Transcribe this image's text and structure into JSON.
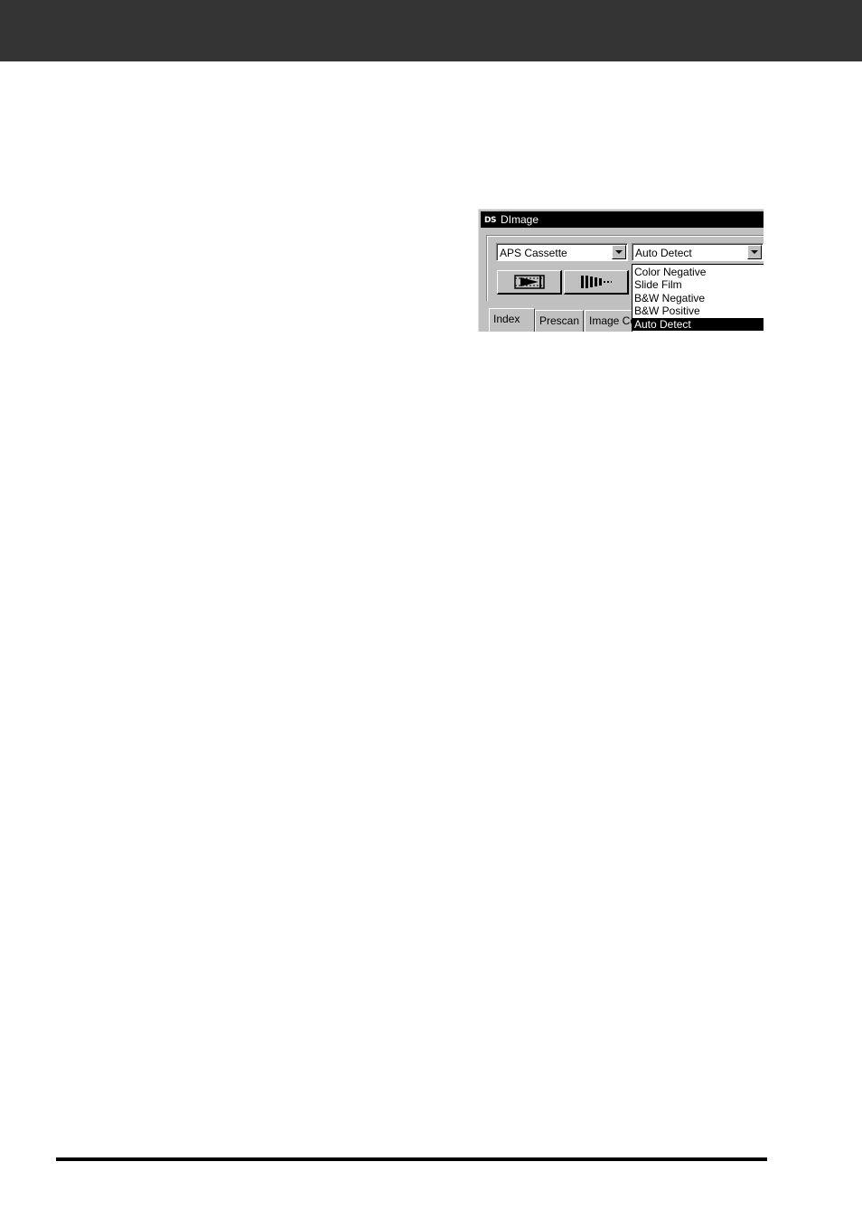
{
  "window": {
    "title": "DImage",
    "app_icon_text": "DS"
  },
  "film_holder_select": {
    "value": "APS Cassette"
  },
  "film_type_select": {
    "value": "Auto Detect",
    "options": [
      "Color Negative",
      "Slide Film",
      "B&W Negative",
      "B&W Positive",
      "Auto Detect"
    ],
    "highlighted_option": "Auto Detect"
  },
  "toolbar": {
    "buttons": [
      "film-advance",
      "film-rewind"
    ]
  },
  "tabs": [
    "Index",
    "Prescan",
    "Image Co"
  ],
  "colors": {
    "header_band": "#343434",
    "titlebar": "#000000",
    "dialog_face": "#c0c0c0",
    "selection": "#000000"
  }
}
